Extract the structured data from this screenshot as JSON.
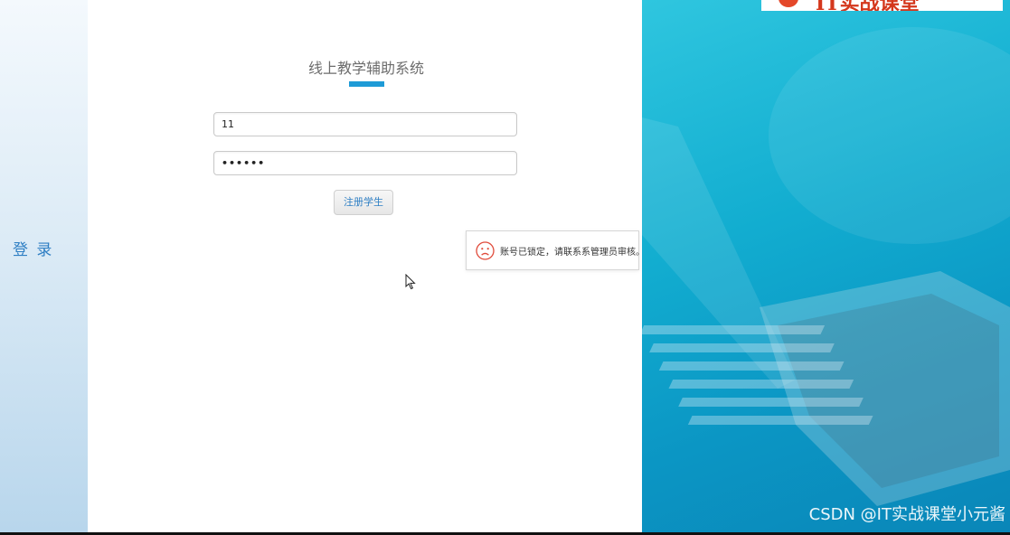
{
  "sidebar": {
    "label": "登 录"
  },
  "login": {
    "title": "线上教学辅助系统",
    "username_value": "11",
    "password_value": "••••••",
    "register_label": "注册学生"
  },
  "toast": {
    "icon": "sad-face-icon",
    "message": "账号已锁定，请联系系管理员审核。"
  },
  "photo": {
    "brand_text": "IT实战课堂"
  },
  "watermark": "CSDN @IT实战课堂小元酱",
  "colors": {
    "accent": "#1e9bd7",
    "link": "#2f7fc4",
    "error": "#e04a3a"
  }
}
